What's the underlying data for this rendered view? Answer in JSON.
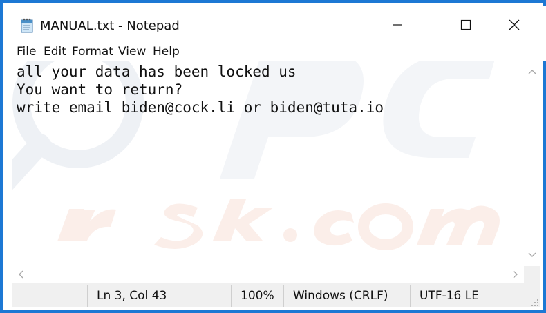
{
  "window": {
    "title": "MANUAL.txt - Notepad",
    "icon": "notepad-icon",
    "controls": [
      "minimize-icon",
      "maximize-icon",
      "close-icon"
    ],
    "accent_color": "#1d78d4"
  },
  "menu": {
    "file": "File",
    "edit": "Edit",
    "format": "Format",
    "view": "View",
    "help": "Help"
  },
  "editor": {
    "lines": [
      "all your data has been locked us",
      "You want to return?",
      "write email biden@cock.li or biden@tuta.io"
    ]
  },
  "status": {
    "position": "Ln 3, Col 43",
    "zoom": "100%",
    "line_ending": "Windows (CRLF)",
    "encoding": "UTF-16 LE"
  }
}
